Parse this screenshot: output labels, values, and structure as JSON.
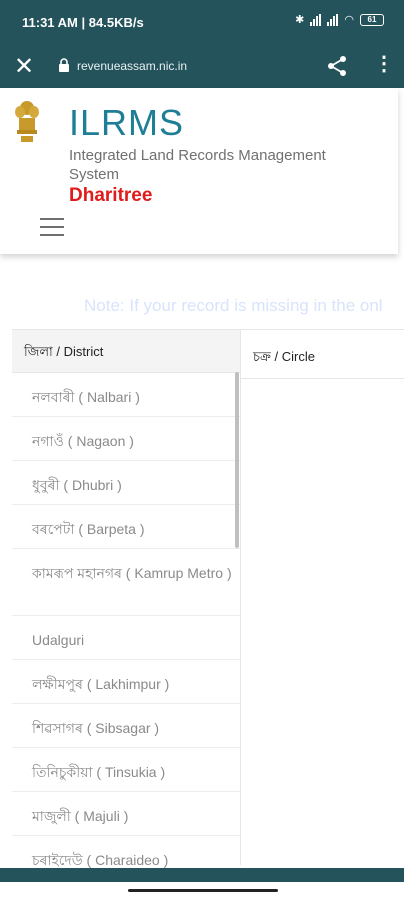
{
  "status_bar": {
    "time": "11:31 AM",
    "speed": "84.5KB/s",
    "battery": "61"
  },
  "browser": {
    "url": "revenueassam.nic.in"
  },
  "header": {
    "title": "ILRMS",
    "subtitle": "Integrated Land Records Management System",
    "brand": "Dharitree"
  },
  "note": "Note: If your record is missing in the onl",
  "district_panel": {
    "header": "জিলা / District",
    "items": [
      "নলবাৰী ( Nalbari )",
      "নগাওঁ ( Nagaon )",
      "ধুবুৰী ( Dhubri )",
      "বৰপেটা ( Barpeta )",
      "কামৰূপ মহানগৰ ( Kamrup Metro )",
      "Udalguri",
      "লক্ষীমপুৰ ( Lakhimpur )",
      "শিৱসাগৰ ( Sibsagar )",
      "তিনিচুকীয়া ( Tinsukia )",
      "মাজুলী ( Majuli )",
      "চৰাইদেউ ( Charaideo )"
    ]
  },
  "circle_panel": {
    "header": "চক্ৰ / Circle"
  },
  "colors": {
    "toolbar": "#24535c",
    "title": "#1d7e95",
    "brand": "#e01b1b"
  }
}
